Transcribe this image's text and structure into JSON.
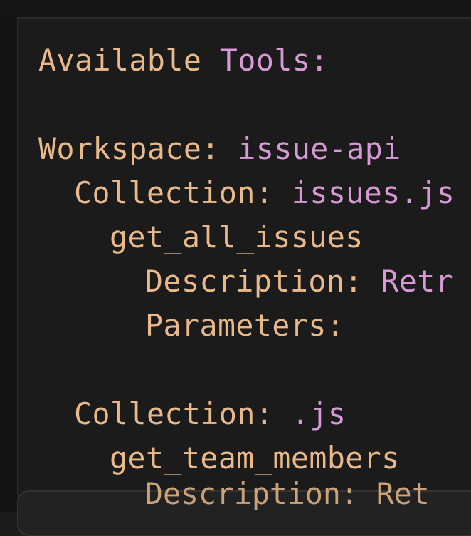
{
  "code": {
    "header_key": "Available",
    "header_value": "Tools:",
    "workspace_label": "Workspace:",
    "workspace_value": "issue-api",
    "collection1_label": "Collection:",
    "collection1_value": "issues.js",
    "tool1_name": "get_all_issues",
    "description_label": "Description:",
    "description_value_clipped": "Retr",
    "parameters_label": "Parameters:",
    "collection2_label": "Collection:",
    "collection2_value": ".js",
    "tool2_name": "get_team_members",
    "partial_line": "Description: Ret"
  },
  "colors": {
    "background": "#1b1b1b",
    "key": "#e9b98a",
    "value": "#d79ad6"
  }
}
